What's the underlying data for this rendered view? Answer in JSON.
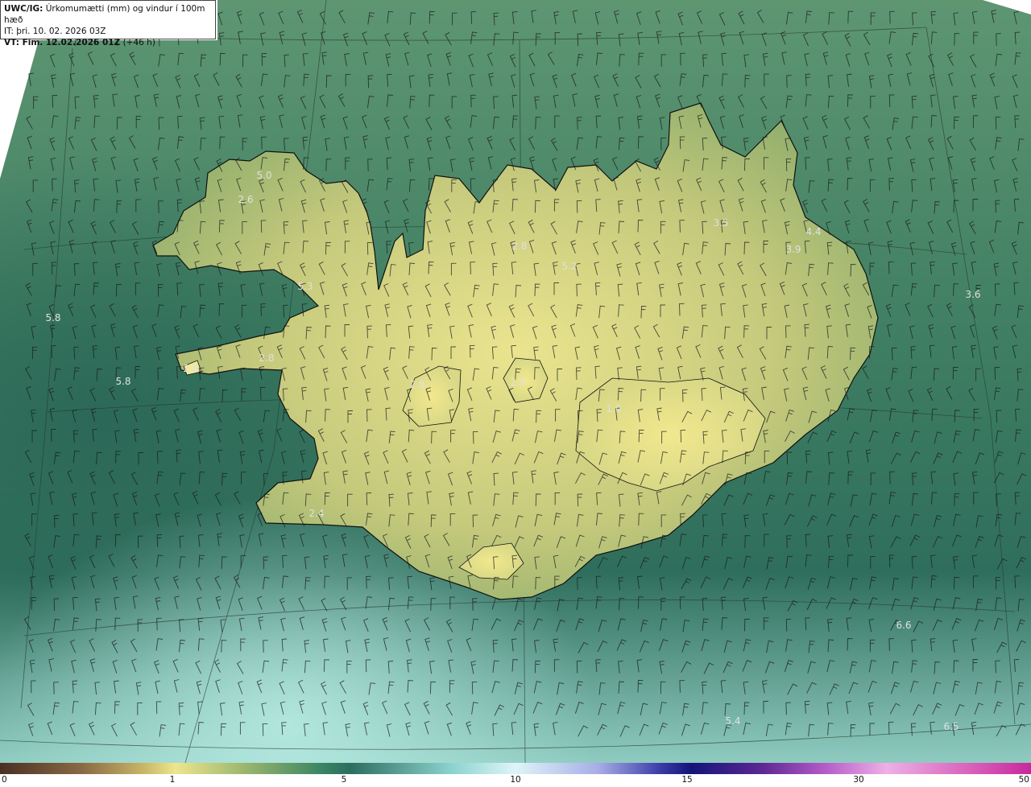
{
  "header": {
    "model_name": "UWC/IG:",
    "title": "Úrkomumætti (mm) og vindur í 100m hæð",
    "init_time": "IT: þri. 10. 02. 2026 03Z",
    "valid_label": "VT: Fim. 12.02.2026 01Z",
    "lead_time": "(+46 h)"
  },
  "value_labels": [
    "5.0",
    "2.6",
    "5.3",
    "5.8",
    "5.8",
    "2.8",
    "2.8",
    "2.8",
    "2.8",
    "2.4",
    "1.0",
    "5.2",
    "3.5",
    "4.4",
    "3.9",
    "3.6",
    "6.6",
    "5.4",
    "6.5",
    "2.8"
  ],
  "colorbar": {
    "ticks": [
      "0",
      "1",
      "5",
      "10",
      "15",
      "30",
      "50"
    ],
    "stops": [
      {
        "color": "#4a2f26"
      },
      {
        "color": "#8a6a44"
      },
      {
        "color": "#c9b768"
      },
      {
        "color": "#ede68c"
      },
      {
        "color": "#98b46e"
      },
      {
        "color": "#3c8664"
      },
      {
        "color": "#2c6e60"
      },
      {
        "color": "#8ed4d0"
      },
      {
        "color": "#dff4f8"
      },
      {
        "color": "#a7aee6"
      },
      {
        "color": "#3c3ca8"
      },
      {
        "color": "#14147a"
      },
      {
        "color": "#5e2894"
      },
      {
        "color": "#b45cc8"
      },
      {
        "color": "#eeb0e6"
      },
      {
        "color": "#c8289c"
      }
    ]
  },
  "colors": {
    "sea_dark": "#2f6e5a",
    "sea_mid": "#4e8a64",
    "land_low": "#c4cc80",
    "land_high": "#e6e08c",
    "coast": "#111111",
    "wind_barb": "#1a1a1a"
  }
}
